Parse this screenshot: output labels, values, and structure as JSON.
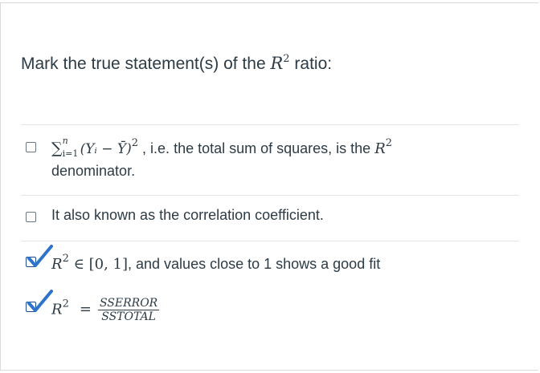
{
  "question": {
    "prefix": "Mark the true statement(s) of the ",
    "r_symbol": "R",
    "r_exp": "2",
    "suffix": " ratio:"
  },
  "options": [
    {
      "checked": false,
      "math_sum": "∑",
      "math_sum_top": "n",
      "math_sum_bottom": "i=1",
      "math_expr": "(Yᵢ − Ȳ)",
      "math_exp": "2",
      "text": " , i.e. the total sum of squares, is the ",
      "r_symbol": "R",
      "r_exp": "2",
      "text2": "denominator."
    },
    {
      "checked": false,
      "text": "It also known as the correlation coefficient."
    },
    {
      "checked": true,
      "r_symbol": "R",
      "r_exp": "2",
      "math": " ∈ [0, 1]",
      "text": ", and values close to 1 shows a good fit"
    },
    {
      "checked": true,
      "r_symbol": "R",
      "r_exp": "2",
      "eq": "=",
      "numerator": "SSERROR",
      "denominator": "SSTOTAL"
    }
  ],
  "colors": {
    "text": "#2d3b45",
    "checkmark": "#2e74c9",
    "checkbox_border": "#6b7780",
    "separator": "#e3e6e8"
  }
}
